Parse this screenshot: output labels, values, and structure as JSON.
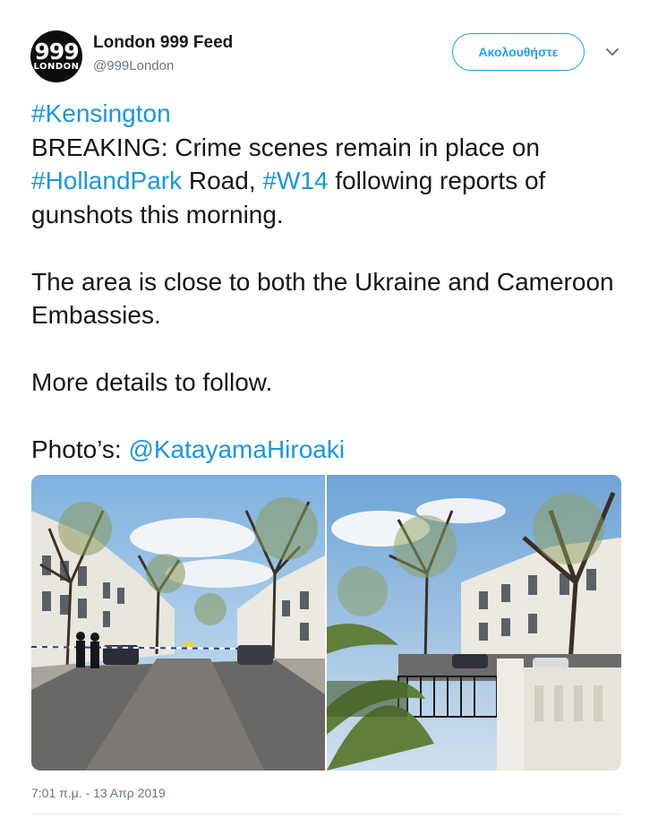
{
  "header": {
    "avatar_text_big": "999",
    "avatar_text_small": "LONDON",
    "display_name": "London 999 Feed",
    "handle": "@999London",
    "follow_label": "Ακολουθήστε",
    "caret_icon": "chevron-down-icon"
  },
  "tweet": {
    "line1_hashtag": "#Kensington",
    "p1_text_a": "BREAKING: Crime scenes remain in place on ",
    "p1_hashtag_a": "#HollandPark",
    "p1_text_b": " Road, ",
    "p1_hashtag_b": "#W14",
    "p1_text_c": " following reports of gunshots this morning.",
    "p2_text": "The area is close to both the Ukraine and Cameroon Embassies.",
    "p3_text": "More details to follow.",
    "p4_text": "Photo’s: ",
    "p4_mention": "@KatayamaHiroaki"
  },
  "media": {
    "photo_left": "street-scene-photo",
    "photo_right": "townhouse-street-photo"
  },
  "footer": {
    "timestamp": "7:01 π.μ. - 13 Απρ 2019"
  },
  "colors": {
    "link": "#1b95e0",
    "follow": "#1da1f2",
    "secondary_text": "#657786"
  }
}
